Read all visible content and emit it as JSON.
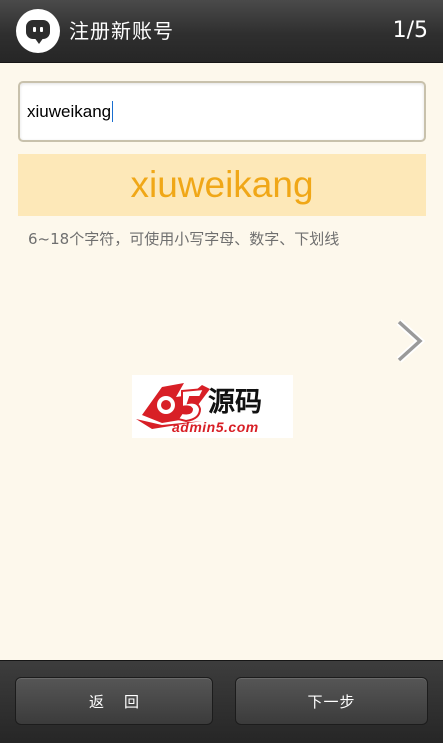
{
  "header": {
    "title": "注册新账号",
    "step_indicator": "1/5",
    "logo_icon": "chat-bubble-icon"
  },
  "form": {
    "account_value": "xiuweikang",
    "preview_text": "xiuweikang",
    "hint": "6~18个字符，可使用小写字母、数字、下划线"
  },
  "navigation": {
    "next_arrow_icon": "chevron-right-icon"
  },
  "watermark": {
    "brand_text": "源码",
    "site_text": "admin5.com"
  },
  "footer": {
    "back_label": "返回",
    "next_label": "下一步"
  },
  "colors": {
    "preview_bg": "#fde8b8",
    "preview_text": "#f0a717",
    "page_bg": "#fdf8ec",
    "bar_dark": "#2f2f2f",
    "watermark_red": "#d81f26"
  }
}
